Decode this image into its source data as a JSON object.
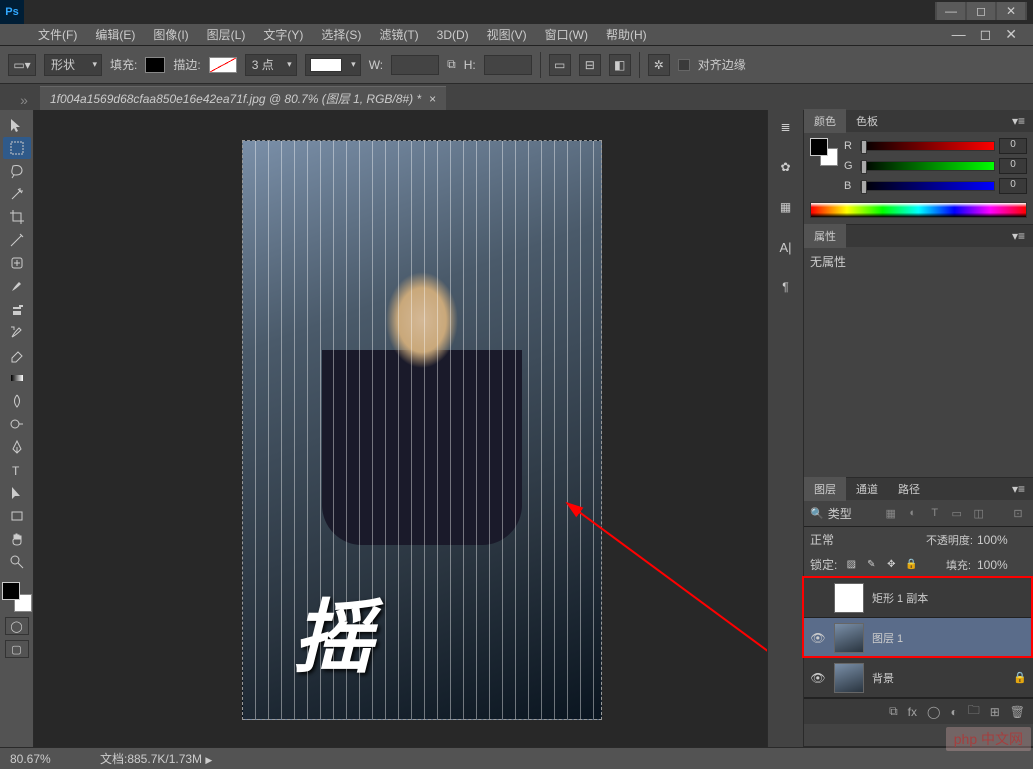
{
  "app": {
    "logo": "Ps"
  },
  "menu": {
    "file": "文件(F)",
    "edit": "编辑(E)",
    "image": "图像(I)",
    "layer": "图层(L)",
    "type": "文字(Y)",
    "select": "选择(S)",
    "filter": "滤镜(T)",
    "threed": "3D(D)",
    "view": "视图(V)",
    "window": "窗口(W)",
    "help": "帮助(H)"
  },
  "options": {
    "shape_label": "形状",
    "fill_label": "填充:",
    "stroke_label": "描边:",
    "stroke_width": "3 点",
    "w_label": "W:",
    "h_label": "H:",
    "align_label": "对齐边缘"
  },
  "document": {
    "tab_title": "1f004a1569d68cfaa850e16e42ea71f.jpg @ 80.7% (图层 1, RGB/8#) *"
  },
  "panels": {
    "color": {
      "tab": "颜色",
      "tab2": "色板",
      "r": "R",
      "g": "G",
      "b": "B",
      "r_val": "0",
      "g_val": "0",
      "b_val": "0"
    },
    "properties": {
      "tab": "属性",
      "no_props": "无属性"
    },
    "layers": {
      "tab": "图层",
      "tab2": "通道",
      "tab3": "路径",
      "filter_type": "类型",
      "blend_mode": "正常",
      "opacity_label": "不透明度:",
      "opacity_val": "100%",
      "lock_label": "锁定:",
      "fill_label": "填充:",
      "fill_val": "100%",
      "items": [
        {
          "name": "矩形 1 副本",
          "visible": false,
          "locked": false,
          "thumb": "white"
        },
        {
          "name": "图层 1",
          "visible": true,
          "locked": false,
          "thumb": "img",
          "selected": true
        },
        {
          "name": "背景",
          "visible": true,
          "locked": true,
          "thumb": "img"
        }
      ]
    }
  },
  "status": {
    "zoom": "80.67%",
    "doc_info": "文档:885.7K/1.73M"
  },
  "watermark": "php 中文网"
}
